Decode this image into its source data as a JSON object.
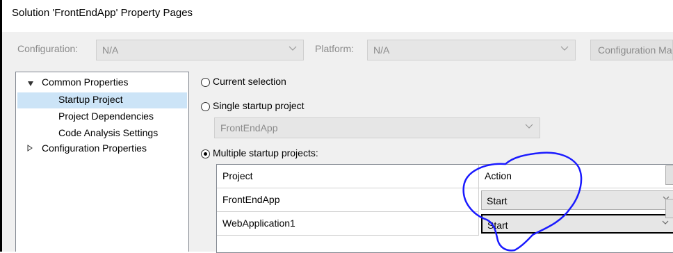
{
  "window": {
    "title": "Solution 'FrontEndApp' Property Pages",
    "title_close_glyph": "?"
  },
  "config_bar": {
    "configuration_label": "Configuration:",
    "configuration_value": "N/A",
    "platform_label": "Platform:",
    "platform_value": "N/A",
    "configuration_manager_label": "Configuration Manager..."
  },
  "tree": {
    "items": [
      {
        "label": "Common Properties",
        "expanded": true
      },
      {
        "label": "Startup Project",
        "selected": true
      },
      {
        "label": "Project Dependencies"
      },
      {
        "label": "Code Analysis Settings"
      },
      {
        "label": "Configuration Properties",
        "expanded": false
      }
    ]
  },
  "startup": {
    "current_selection_label": "Current selection",
    "single_startup_label": "Single startup project",
    "single_startup_value": "FrontEndApp",
    "multiple_startup_label": "Multiple startup projects:",
    "selected_option": "multiple"
  },
  "grid": {
    "columns": [
      "Project",
      "Action"
    ],
    "rows": [
      {
        "project": "FrontEndApp",
        "action": "Start"
      },
      {
        "project": "WebApplication1",
        "action": "Start"
      }
    ]
  },
  "colors": {
    "annotation_ink": "#1a1aff",
    "selection": "#cce4f7"
  }
}
